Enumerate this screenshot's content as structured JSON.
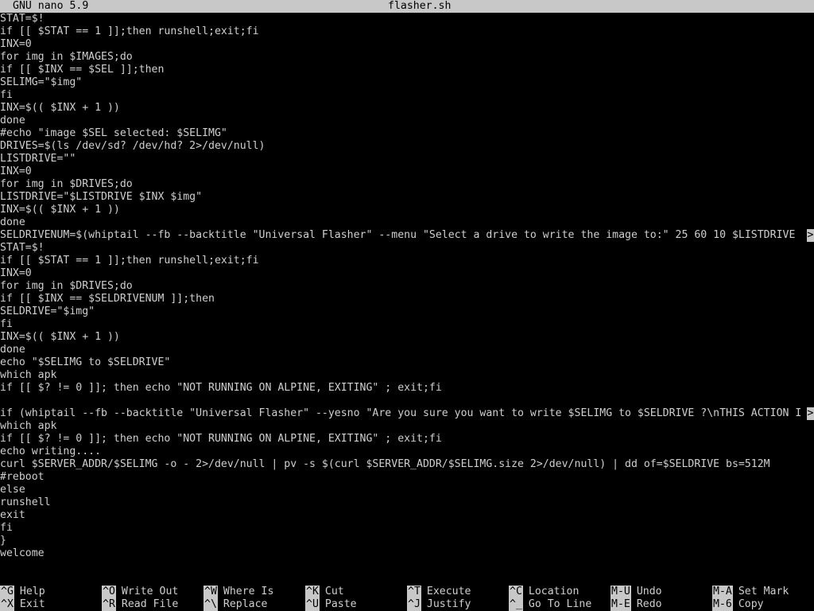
{
  "titlebar": {
    "app_name": "GNU nano 5.9",
    "file_name": "flasher.sh"
  },
  "editor": {
    "lines": [
      "STAT=$!",
      "if [[ $STAT == 1 ]];then runshell;exit;fi",
      "INX=0",
      "for img in $IMAGES;do",
      "if [[ $INX == $SEL ]];then",
      "SELIMG=\"$img\"",
      "fi",
      "INX=$(( $INX + 1 ))",
      "done",
      "#echo \"image $SEL selected: $SELIMG\"",
      "DRIVES=$(ls /dev/sd? /dev/hd? 2>/dev/null)",
      "LISTDRIVE=\"\"",
      "INX=0",
      "for img in $DRIVES;do",
      "LISTDRIVE=\"$LISTDRIVE $INX $img\"",
      "INX=$(( $INX + 1 ))",
      "done",
      "SELDRIVENUM=$(whiptail --fb --backtitle \"Universal Flasher\" --menu \"Select a drive to write the image to:\" 25 60 10 $LISTDRIVE",
      "STAT=$!",
      "if [[ $STAT == 1 ]];then runshell;exit;fi",
      "INX=0",
      "for img in $DRIVES;do",
      "if [[ $INX == $SELDRIVENUM ]];then",
      "SELDRIVE=\"$img\"",
      "fi",
      "INX=$(( $INX + 1 ))",
      "done",
      "echo \"$SELIMG to $SELDRIVE\"",
      "which apk",
      "if [[ $? != 0 ]]; then echo \"NOT RUNNING ON ALPINE, EXITING\" ; exit;fi",
      "",
      "if (whiptail --fb --backtitle \"Universal Flasher\" --yesno \"Are you sure you want to write $SELIMG to $SELDRIVE ?\\nTHIS ACTION I",
      "which apk",
      "if [[ $? != 0 ]]; then echo \"NOT RUNNING ON ALPINE, EXITING\" ; exit;fi",
      "echo writing....",
      "curl $SERVER_ADDR/$SELIMG -o - 2>/dev/null | pv -s $(curl $SERVER_ADDR/$SELIMG.size 2>/dev/null) | dd of=$SELDRIVE bs=512M",
      "#reboot",
      "else",
      "runshell",
      "exit",
      "fi",
      "}",
      "welcome",
      ""
    ],
    "truncated_lines": [
      17,
      31
    ],
    "truncation_marker": ">"
  },
  "shortcuts": {
    "row1": [
      {
        "key": "^G",
        "label": "Help"
      },
      {
        "key": "^O",
        "label": "Write Out"
      },
      {
        "key": "^W",
        "label": "Where Is"
      },
      {
        "key": "^K",
        "label": "Cut"
      },
      {
        "key": "^T",
        "label": "Execute"
      },
      {
        "key": "^C",
        "label": "Location"
      },
      {
        "key": "M-U",
        "label": "Undo"
      },
      {
        "key": "M-A",
        "label": "Set Mark"
      }
    ],
    "row2": [
      {
        "key": "^X",
        "label": "Exit"
      },
      {
        "key": "^R",
        "label": "Read File"
      },
      {
        "key": "^\\",
        "label": "Replace"
      },
      {
        "key": "^U",
        "label": "Paste"
      },
      {
        "key": "^J",
        "label": "Justify"
      },
      {
        "key": "^_",
        "label": "Go To Line"
      },
      {
        "key": "M-E",
        "label": "Redo"
      },
      {
        "key": "M-6",
        "label": "Copy"
      }
    ]
  }
}
